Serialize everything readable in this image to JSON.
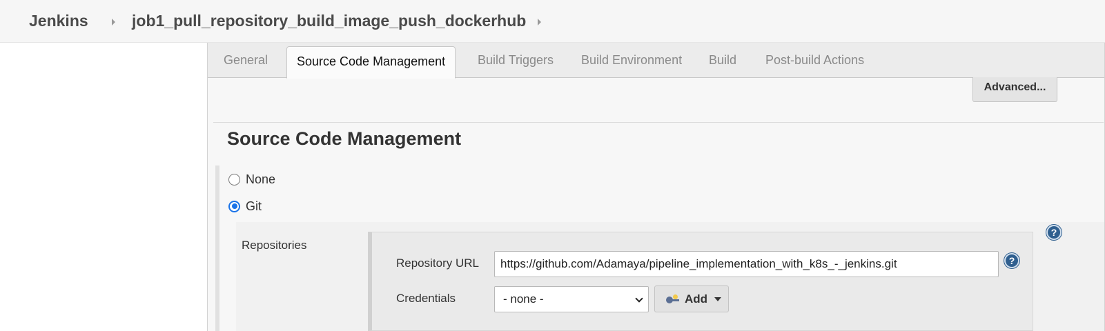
{
  "breadcrumb": {
    "root": "Jenkins",
    "job": "job1_pull_repository_build_image_push_dockerhub"
  },
  "tabs": [
    {
      "label": "General",
      "active": false
    },
    {
      "label": "Source Code Management",
      "active": true
    },
    {
      "label": "Build Triggers",
      "active": false
    },
    {
      "label": "Build Environment",
      "active": false
    },
    {
      "label": "Build",
      "active": false
    },
    {
      "label": "Post-build Actions",
      "active": false
    }
  ],
  "advanced_button": "Advanced...",
  "scm": {
    "title": "Source Code Management",
    "options": [
      {
        "label": "None",
        "checked": false
      },
      {
        "label": "Git",
        "checked": true
      }
    ],
    "repositories_label": "Repositories",
    "repository_url_label": "Repository URL",
    "repository_url_value": "https://github.com/Adamaya/pipeline_implementation_with_k8s_-_jenkins.git",
    "credentials_label": "Credentials",
    "credentials_value": "- none -",
    "add_button": "Add"
  },
  "help_glyph": "?",
  "colors": {
    "accent_blue": "#1a73e8",
    "help_blue": "#2f5f8f",
    "panel_bg": "#f7f7f7",
    "tabbar_bg": "#ececec"
  },
  "icons": [
    "chevron-right-icon",
    "key-icon",
    "dropdown-caret-icon",
    "help-icon",
    "chevron-down-icon"
  ]
}
